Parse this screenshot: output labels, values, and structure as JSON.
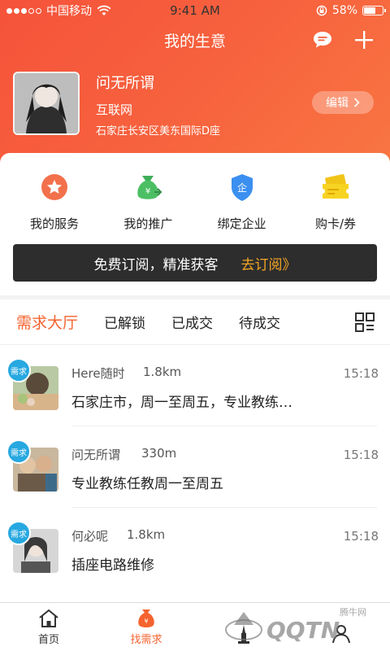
{
  "status": {
    "carrier": "中国移动",
    "time": "9:41 AM",
    "battery": "58%"
  },
  "nav": {
    "title": "我的生意"
  },
  "profile": {
    "name": "问无所谓",
    "company": "互联网",
    "address": "石家庄长安区美东国际D座",
    "edit_label": "编辑"
  },
  "services": [
    {
      "label": "我的服务",
      "icon": "star-badge-icon"
    },
    {
      "label": "我的推广",
      "icon": "money-bag-icon"
    },
    {
      "label": "绑定企业",
      "icon": "enterprise-shield-icon"
    },
    {
      "label": "购卡/券",
      "icon": "card-ticket-icon"
    }
  ],
  "subscribe": {
    "text": "免费订阅，精准获客",
    "link": "去订阅》"
  },
  "tabs": [
    "需求大厅",
    "已解锁",
    "已成交",
    "待成交"
  ],
  "demands": [
    {
      "badge": "需求",
      "name": "Here随时",
      "distance": "1.8km",
      "time": "15:18",
      "desc": "石家庄市，周一至周五，专业教练…"
    },
    {
      "badge": "需求",
      "name": "问无所谓",
      "distance": "330m",
      "time": "15:18",
      "desc": "专业教练任教周一至周五"
    },
    {
      "badge": "需求",
      "name": "何必呢",
      "distance": "1.8km",
      "time": "15:18",
      "desc": "插座电路维修"
    }
  ],
  "tabbar": [
    {
      "label": "首页"
    },
    {
      "label": "找需求"
    },
    {
      "label": ""
    },
    {
      "label": ""
    }
  ],
  "watermark": {
    "text": "腾牛网",
    "logo": "QQTN"
  },
  "colors": {
    "accent": "#f5632f",
    "header_start": "#f5533a",
    "header_end": "#f87642",
    "badge": "#27a8e0",
    "banner_bg": "#2d2d2d",
    "banner_link": "#f5a623"
  }
}
